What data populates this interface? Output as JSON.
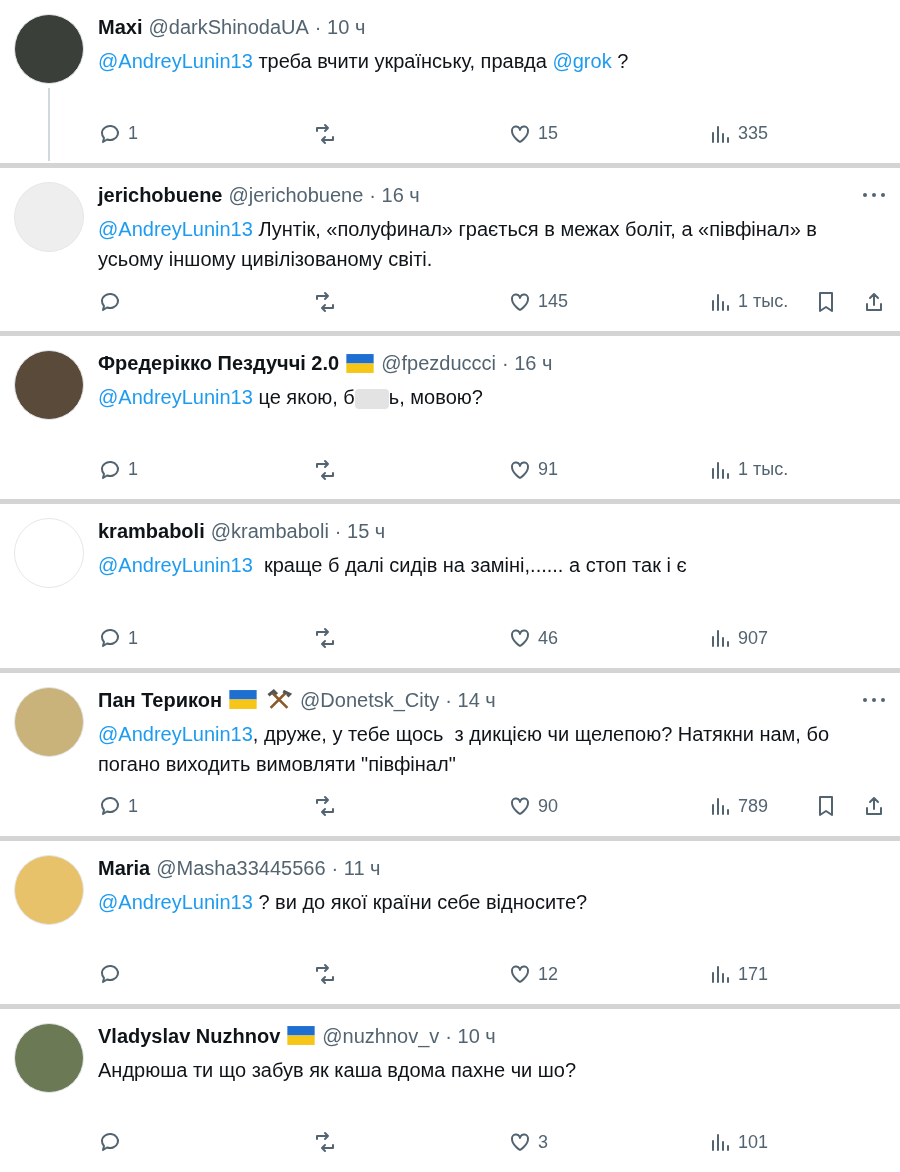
{
  "tweets": [
    {
      "name": "Maxi",
      "handle": "@darkShinodaUA",
      "time": "· 10 ч",
      "color": "#3a3f3a",
      "thread_line": true,
      "more": false,
      "text": [
        {
          "kind": "mention",
          "text": "@AndreyLunin13"
        },
        {
          "kind": "plain",
          "text": " треба вчити українську, правда "
        },
        {
          "kind": "mention",
          "text": "@grok"
        },
        {
          "kind": "plain",
          "text": " ?"
        }
      ],
      "replies": "1",
      "likes": "15",
      "views": "335",
      "extra_actions": false
    },
    {
      "name": "jerichobuene",
      "handle": "@jerichobuene",
      "time": "· 16 ч",
      "color": "#eeeeee",
      "thread_line": false,
      "more": true,
      "text": [
        {
          "kind": "mention",
          "text": "@AndreyLunin13"
        },
        {
          "kind": "plain",
          "text": " Лунтік, «полуфинал» грається в межах боліт, а «півфінал» в усьому іншому цивілізованому світі."
        }
      ],
      "likes": "145",
      "views": "1 тыс.",
      "extra_actions": true
    },
    {
      "name": "Фредерікко Пездуччі 2.0",
      "badges": [
        {
          "kind": "flag"
        }
      ],
      "handle": "@fpezduccci",
      "time": "· 16 ч",
      "color": "#5a4a3a",
      "thread_line": false,
      "more": false,
      "text": [
        {
          "kind": "mention",
          "text": "@AndreyLunin13"
        },
        {
          "kind": "plain",
          "text": " це якою, б"
        },
        {
          "kind": "blurred"
        },
        {
          "kind": "plain",
          "text": "ь, мовою?"
        }
      ],
      "replies": "1",
      "likes": "91",
      "views": "1 тыс.",
      "extra_actions": false
    },
    {
      "name": "krambaboli",
      "handle": "@krambaboli",
      "time": "· 15 ч",
      "color": "#ffffff",
      "thread_line": false,
      "more": false,
      "text": [
        {
          "kind": "mention",
          "text": "@AndreyLunin13"
        },
        {
          "kind": "plain",
          "text": "  краще б далі сидів на заміні,...... а стоп так і є"
        }
      ],
      "replies": "1",
      "likes": "46",
      "views": "907",
      "extra_actions": false
    },
    {
      "name": "Пан Терикон",
      "badges": [
        {
          "kind": "flag"
        },
        {
          "kind": "hammers"
        }
      ],
      "handle": "@Donetsk_City",
      "time": "· 14 ч",
      "color": "#c9b37a",
      "thread_line": false,
      "more": true,
      "text": [
        {
          "kind": "mention",
          "text": "@AndreyLunin13"
        },
        {
          "kind": "plain",
          "text": ", друже, у тебе щось  з дикцією чи щелепою? Натякни нам, бо погано виходить вимовляти \"півфінал\""
        }
      ],
      "replies": "1",
      "likes": "90",
      "views": "789",
      "extra_actions": true
    },
    {
      "name": "Maria",
      "handle": "@Masha33445566",
      "time": "· 11 ч",
      "color": "#e8c26a",
      "thread_line": false,
      "more": false,
      "text": [
        {
          "kind": "mention",
          "text": "@AndreyLunin13"
        },
        {
          "kind": "plain",
          "text": " ? ви до якої країни себе відносите?"
        }
      ],
      "likes": "12",
      "views": "171",
      "extra_actions": false
    },
    {
      "name": "Vladyslav Nuzhnov",
      "badges": [
        {
          "kind": "flag"
        }
      ],
      "handle": "@nuzhnov_v",
      "time": "· 10 ч",
      "color": "#6b7a55",
      "thread_line": false,
      "more": false,
      "text": [
        {
          "kind": "plain",
          "text": "Андрюша ти що забув як каша вдома пахне чи шо?"
        }
      ],
      "likes": "3",
      "views": "101",
      "extra_actions": false
    }
  ]
}
